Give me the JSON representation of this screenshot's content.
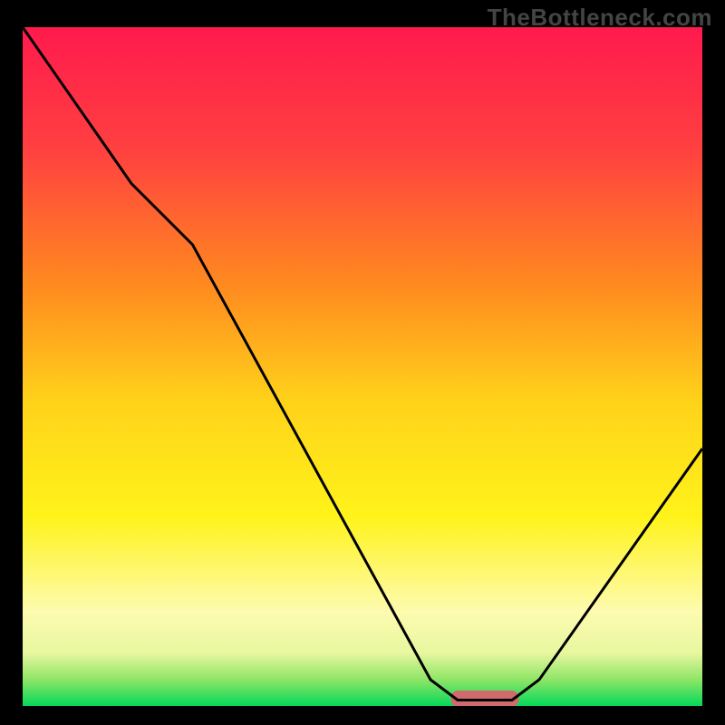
{
  "watermark": "TheBottleneck.com",
  "chart_data": {
    "type": "line",
    "title": "",
    "xlabel": "",
    "ylabel": "",
    "xlim": [
      0,
      100
    ],
    "ylim": [
      0,
      100
    ],
    "curve": {
      "name": "bottleneck-curve",
      "points": [
        {
          "x": 0,
          "y": 100
        },
        {
          "x": 16,
          "y": 77
        },
        {
          "x": 25,
          "y": 68
        },
        {
          "x": 60,
          "y": 4
        },
        {
          "x": 64,
          "y": 1
        },
        {
          "x": 72,
          "y": 1
        },
        {
          "x": 76,
          "y": 4
        },
        {
          "x": 100,
          "y": 38
        }
      ]
    },
    "marker": {
      "x": 68,
      "y": 1.2,
      "width": 10,
      "height": 2.4,
      "color": "#d16a6d"
    },
    "gradient_stops": [
      {
        "offset": 0.0,
        "color": "#ff1a4d"
      },
      {
        "offset": 0.18,
        "color": "#ff4040"
      },
      {
        "offset": 0.38,
        "color": "#ff8a1f"
      },
      {
        "offset": 0.55,
        "color": "#ffd21a"
      },
      {
        "offset": 0.72,
        "color": "#fff31a"
      },
      {
        "offset": 0.86,
        "color": "#fdfbb0"
      },
      {
        "offset": 0.92,
        "color": "#e8f7a0"
      },
      {
        "offset": 0.96,
        "color": "#8ee566"
      },
      {
        "offset": 1.0,
        "color": "#00d85a"
      }
    ],
    "axis_color": "#000000",
    "curve_color": "#000000"
  }
}
